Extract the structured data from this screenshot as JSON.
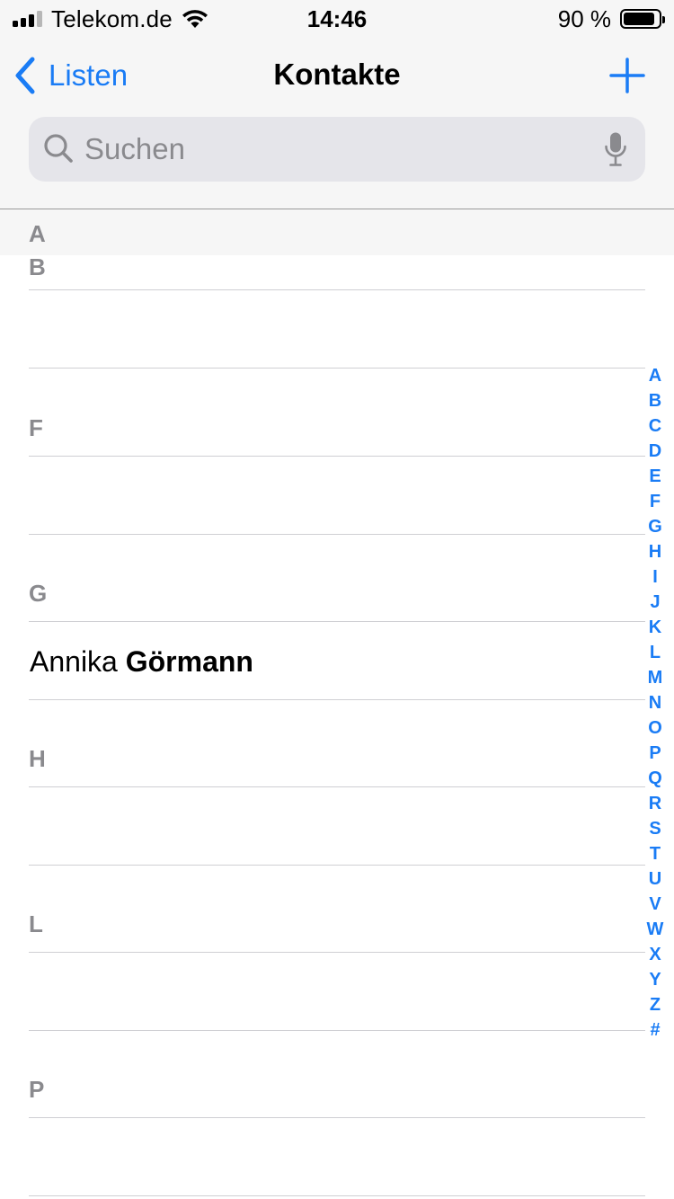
{
  "status": {
    "carrier": "Telekom.de",
    "time": "14:46",
    "battery_percent": "90 %",
    "battery_level": 0.9,
    "signal_bars": 3,
    "signal_total": 4
  },
  "nav": {
    "back_label": "Listen",
    "title": "Kontakte",
    "add_icon": "plus-icon"
  },
  "search": {
    "placeholder": "Suchen",
    "value": ""
  },
  "sticky_section": "A",
  "sections": [
    {
      "letter": "B",
      "contacts": [
        {
          "first": "",
          "last": ""
        }
      ]
    },
    {
      "letter": "F",
      "contacts": [
        {
          "first": "",
          "last": ""
        }
      ]
    },
    {
      "letter": "G",
      "contacts": [
        {
          "first": "Annika",
          "last": "Görmann"
        }
      ]
    },
    {
      "letter": "H",
      "contacts": [
        {
          "first": "",
          "last": ""
        }
      ]
    },
    {
      "letter": "L",
      "contacts": [
        {
          "first": "",
          "last": ""
        }
      ]
    },
    {
      "letter": "P",
      "contacts": [
        {
          "first": "",
          "last": ""
        }
      ]
    }
  ],
  "index": [
    "A",
    "B",
    "C",
    "D",
    "E",
    "F",
    "G",
    "H",
    "I",
    "J",
    "K",
    "L",
    "M",
    "N",
    "O",
    "P",
    "Q",
    "R",
    "S",
    "T",
    "U",
    "V",
    "W",
    "X",
    "Y",
    "Z",
    "#"
  ],
  "colors": {
    "accent": "#1a7cf5",
    "section_text": "#8a8a8e",
    "chrome_bg": "#f6f6f6"
  }
}
